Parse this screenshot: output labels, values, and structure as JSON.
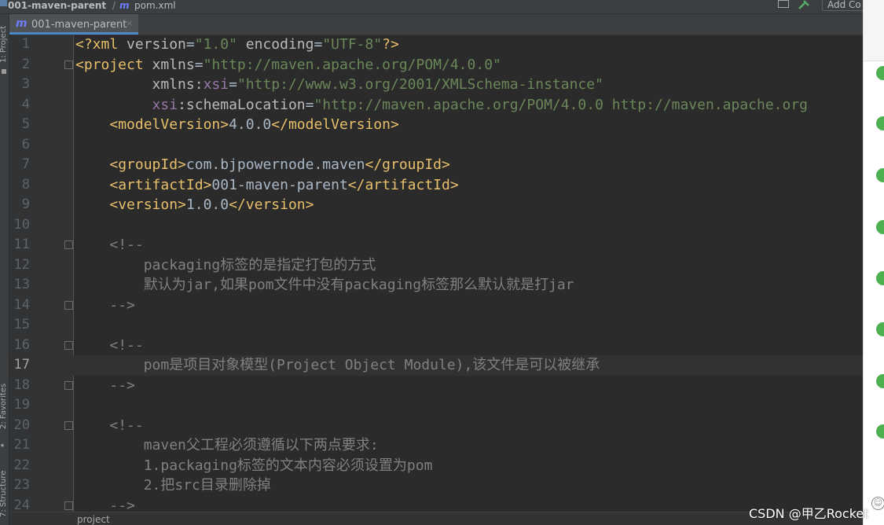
{
  "breadcrumb": {
    "project": "001-maven-parent",
    "separator": "/",
    "module_icon": "m",
    "file": "pom.xml"
  },
  "toolbar": {
    "add_label": "Add Co"
  },
  "left_strip": {
    "project_label": "1: Project",
    "favorites_label": "2: Favorites",
    "structure_label": "7: Structure"
  },
  "tab": {
    "icon": "m",
    "label": "001-maven-parent",
    "close": "×"
  },
  "editor": {
    "current_line": 17,
    "lines": [
      {
        "n": "1",
        "html": "<span class='tag'>&lt;?xml </span><span class='attr'>version</span><span class='txt'>=</span><span class='val'>\"1.0\"</span><span class='attr'> encoding</span><span class='txt'>=</span><span class='val'>\"UTF-8\"</span><span class='tag'>?&gt;</span>"
      },
      {
        "n": "2",
        "fold": "start",
        "html": "<span class='tag'>&lt;project </span><span class='attr'>xmlns</span><span class='txt'>=</span><span class='val'>\"http://maven.apache.org/POM/4.0.0\"</span>"
      },
      {
        "n": "3",
        "html": "         <span class='attr'>xmlns:</span><span class='ns'>xsi</span><span class='txt'>=</span><span class='val'>\"http://www.w3.org/2001/XMLSchema-instance\"</span>"
      },
      {
        "n": "4",
        "html": "         <span class='ns'>xsi</span><span class='attr'>:schemaLocation</span><span class='txt'>=</span><span class='val'>\"http://maven.apache.org/POM/4.0.0 http://maven.apache.org</span>"
      },
      {
        "n": "5",
        "html": "    <span class='tag'>&lt;modelVersion&gt;</span><span class='txt'>4.0.0</span><span class='tag'>&lt;/modelVersion&gt;</span>"
      },
      {
        "n": "6",
        "html": ""
      },
      {
        "n": "7",
        "html": "    <span class='tag'>&lt;groupId&gt;</span><span class='txt'>com.bjpowernode.maven</span><span class='tag'>&lt;/groupId&gt;</span>"
      },
      {
        "n": "8",
        "html": "    <span class='tag'>&lt;artifactId&gt;</span><span class='txt'>001-maven-parent</span><span class='tag'>&lt;/artifactId&gt;</span>"
      },
      {
        "n": "9",
        "html": "    <span class='tag'>&lt;version&gt;</span><span class='txt'>1.0.0</span><span class='tag'>&lt;/version&gt;</span>"
      },
      {
        "n": "10",
        "html": ""
      },
      {
        "n": "11",
        "fold": "start",
        "html": "    <span class='com'>&lt;!--</span>"
      },
      {
        "n": "12",
        "html": "        <span class='com'>packaging标签的是指定打包的方式</span>"
      },
      {
        "n": "13",
        "html": "        <span class='com'>默认为jar,如果pom文件中没有packaging标签那么默认就是打jar</span>"
      },
      {
        "n": "14",
        "fold": "end",
        "html": "    <span class='com'>--&gt;</span>"
      },
      {
        "n": "15",
        "html": ""
      },
      {
        "n": "16",
        "fold": "start",
        "html": "    <span class='com'>&lt;!--</span>"
      },
      {
        "n": "17",
        "html": "        <span class='com'>pom是项目对象模型(Project Object Module),该文件是可以被继承</span>"
      },
      {
        "n": "18",
        "fold": "end",
        "html": "    <span class='com'>--&gt;</span>"
      },
      {
        "n": "19",
        "html": ""
      },
      {
        "n": "20",
        "fold": "start",
        "html": "    <span class='com'>&lt;!--</span>"
      },
      {
        "n": "21",
        "html": "        <span class='com'>maven父工程必须遵循以下两点要求:</span>"
      },
      {
        "n": "22",
        "html": "        <span class='com'>1.packaging标签的文本内容必须设置为pom</span>"
      },
      {
        "n": "23",
        "html": "        <span class='com'>2.把src目录删除掉</span>"
      },
      {
        "n": "24",
        "fold": "end",
        "html": "    <span class='com'>--&gt;</span>"
      }
    ]
  },
  "bottom_breadcrumb": "project",
  "watermark": "CSDN @甲乙Rocket",
  "colors": {
    "tag": "#e8bf6a",
    "attr": "#bababa",
    "namespace": "#9876aa",
    "value": "#6a8759",
    "comment": "#808080",
    "text": "#a9b7c6",
    "background": "#2b2b2b"
  }
}
